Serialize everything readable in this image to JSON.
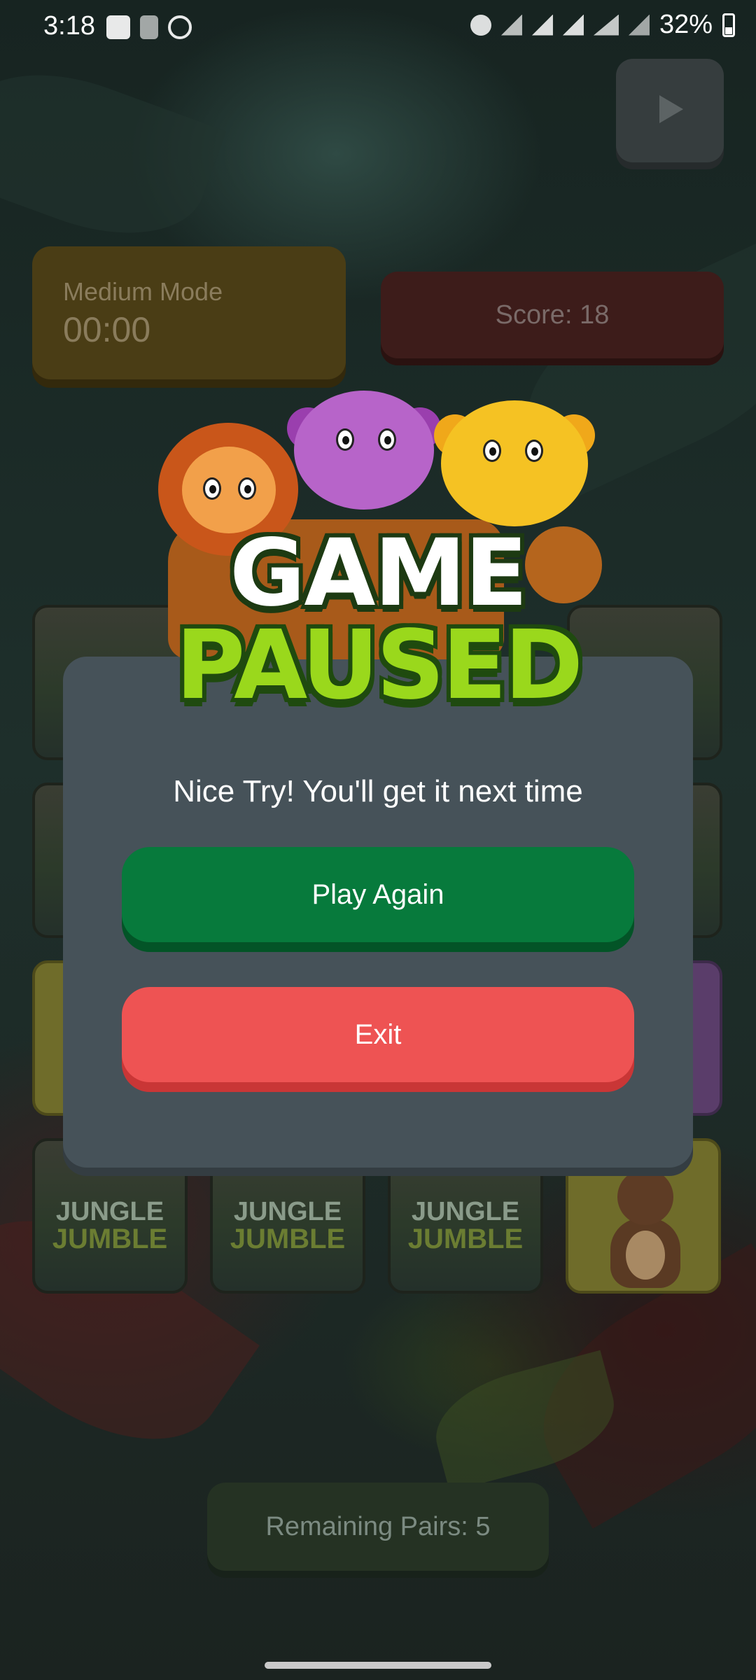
{
  "status_bar": {
    "time": "3:18",
    "battery": "32%",
    "icons": [
      "gallery-icon",
      "signal-question-icon",
      "app-icon",
      "alarm-icon",
      "mute-icon",
      "wifi-icon",
      "signal-icon",
      "volte-icon",
      "signal-icon-2",
      "battery-icon"
    ]
  },
  "hud": {
    "mode_label": "Medium Mode",
    "timer": "00:00",
    "score": "Score: 18",
    "remaining_pairs": "Remaining Pairs: 5"
  },
  "cards": {
    "back_line1": "JUNGLE",
    "back_line2": "JUMBLE"
  },
  "dialog": {
    "title_line1": "GAME",
    "title_line2": "PAUSED",
    "message": "Nice Try! You'll get it next time",
    "play_again": "Play Again",
    "exit": "Exit"
  },
  "colors": {
    "play_again": "#077a3c",
    "exit": "#ee5353",
    "modal": "#465259"
  }
}
